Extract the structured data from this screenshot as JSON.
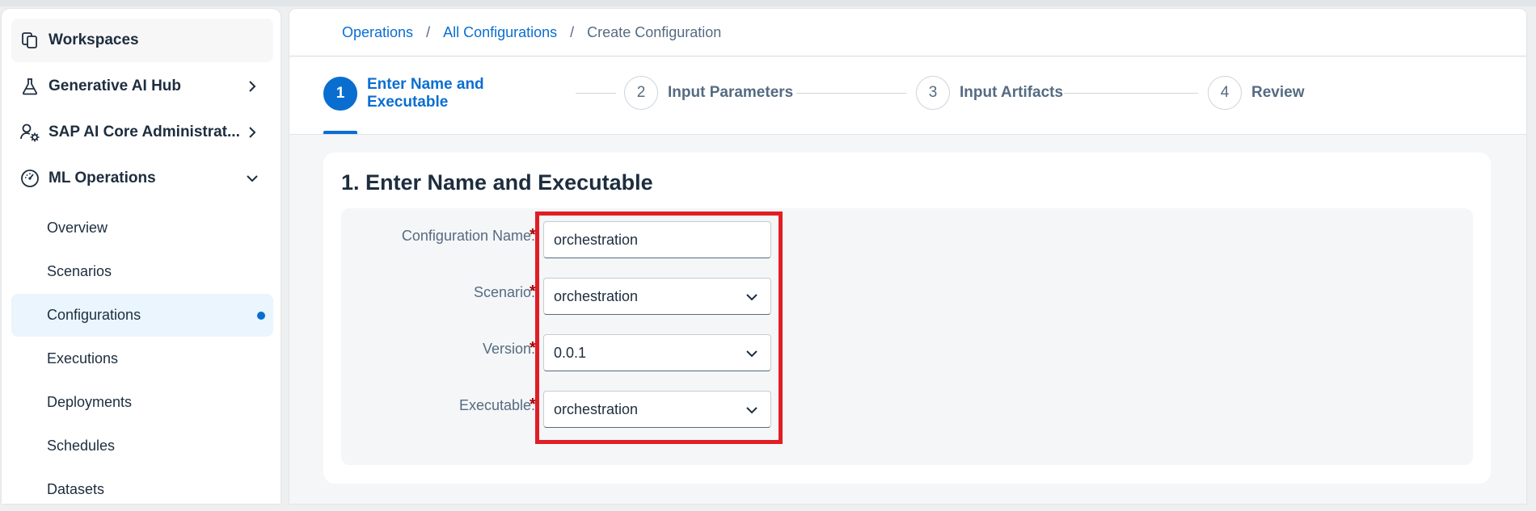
{
  "sidebar": {
    "items": [
      {
        "label": "Workspaces",
        "icon": "workspaces-icon"
      },
      {
        "label": "Generative AI Hub",
        "icon": "flask-icon"
      },
      {
        "label": "SAP AI Core Administrat...",
        "icon": "user-settings-icon"
      },
      {
        "label": "ML Operations",
        "icon": "dashboard-gauge-icon"
      }
    ],
    "subitems": [
      {
        "label": "Overview"
      },
      {
        "label": "Scenarios"
      },
      {
        "label": "Configurations"
      },
      {
        "label": "Executions"
      },
      {
        "label": "Deployments"
      },
      {
        "label": "Schedules"
      },
      {
        "label": "Datasets"
      }
    ]
  },
  "breadcrumb": {
    "items": [
      "Operations",
      "All Configurations",
      "Create Configuration"
    ],
    "separator": "/"
  },
  "wizard": {
    "steps": [
      {
        "number": "1",
        "title": "Enter Name and Executable"
      },
      {
        "number": "2",
        "title": "Input Parameters"
      },
      {
        "number": "3",
        "title": "Input Artifacts"
      },
      {
        "number": "4",
        "title": "Review"
      }
    ],
    "active_step": 1
  },
  "form": {
    "title": "1. Enter Name and Executable",
    "required_marker": "*",
    "fields": [
      {
        "label": "Configuration Name:",
        "value": "orchestration"
      },
      {
        "label": "Scenario:",
        "value": "orchestration"
      },
      {
        "label": "Version:",
        "value": "0.0.1"
      },
      {
        "label": "Executable:",
        "value": "orchestration"
      }
    ]
  },
  "colors": {
    "accent": "#0a6ed1",
    "required": "#aa0808",
    "highlight_box": "#e01e25",
    "text": "#1d2d3e"
  }
}
